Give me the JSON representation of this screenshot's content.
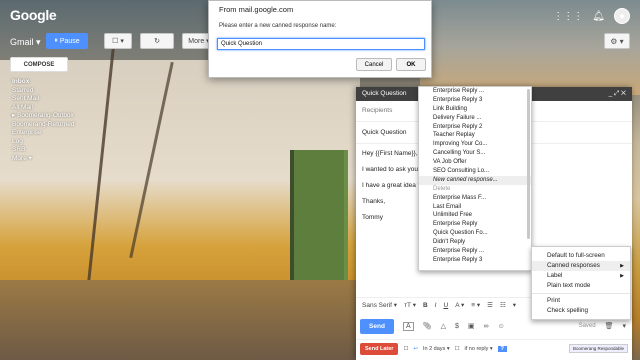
{
  "topbar": {
    "logo": "Google",
    "icons": [
      "grid-icon",
      "bell-icon",
      "avatar"
    ]
  },
  "toolbar": {
    "gmail_label": "Gmail ▾",
    "pause_label": "Pause",
    "more_label": "More ▾",
    "gear_label": "⚙ ▾"
  },
  "sidebar": {
    "compose_label": "COMPOSE",
    "items": [
      {
        "label": "Inbox",
        "bold": true
      },
      {
        "label": "Starred"
      },
      {
        "label": "Sent Mail"
      },
      {
        "label": "All Mail"
      },
      {
        "label": "▸ Boomerang-Outbox"
      },
      {
        "label": "Boomerang-Returned"
      },
      {
        "label": "Enterprise"
      },
      {
        "label": "Log"
      },
      {
        "label": "SRB"
      },
      {
        "label": "More ▾"
      }
    ]
  },
  "dialog": {
    "title": "From mail.google.com",
    "prompt": "Please enter a new canned response name:",
    "value": "Quick Question",
    "cancel_label": "Cancel",
    "ok_label": "OK"
  },
  "compose": {
    "header_title": "Quick Question",
    "header_controls": "_  ⤢  ✕",
    "recipients_placeholder": "Recipients",
    "subject": "Quick Question",
    "body": [
      "Hey {{First Name}},",
      "I wanted to ask you about                                                      mpany}} about widgets?",
      "I have a great idea f                                                          ad you {{Another Piece of Data}}.",
      "Thanks,",
      "Tommy"
    ],
    "format": {
      "font": "Sans Serif ▾",
      "size": "ᴛT ▾",
      "bold": "B",
      "italic": "I",
      "underline": "U",
      "color": "A ▾",
      "align": "≡ ▾",
      "list1": "☰",
      "list2": "☷",
      "more": "▾"
    },
    "send_label": "Send",
    "saved_label": "Saved",
    "send_later_label": "Send Later",
    "in_days": "In 2 days ▾",
    "if_no_reply": "if no reply ▾",
    "help": "?",
    "bm_respondable": "Boomerang Respondable"
  },
  "canned_list": {
    "items": [
      {
        "label": "Enterprise Reply ..."
      },
      {
        "label": "Enterprise Reply 3"
      },
      {
        "label": "Link Building"
      },
      {
        "label": "Delivery Failure ..."
      },
      {
        "label": "Enterprise Reply 2"
      },
      {
        "label": "Teacher Replay"
      },
      {
        "label": "Improving Your Co..."
      },
      {
        "label": "Cancelling Your S..."
      },
      {
        "label": "VA Job Offer"
      },
      {
        "label": "SEO Consulting Lo..."
      },
      {
        "label": "New canned response...",
        "highlight": true
      },
      {
        "label": "Delete",
        "header": true
      },
      {
        "label": "Enterprise Mass F..."
      },
      {
        "label": "Last Email"
      },
      {
        "label": "Unlimited Free"
      },
      {
        "label": "Enterprise Reply"
      },
      {
        "label": "Quick Question Fo..."
      },
      {
        "label": "Didn't Reply"
      },
      {
        "label": "Enterprise Reply ..."
      },
      {
        "label": "Enterprise Reply 3"
      }
    ]
  },
  "more_menu": {
    "items": [
      {
        "label": "Default to full-screen"
      },
      {
        "label": "Canned responses",
        "submenu": true,
        "highlight": true
      },
      {
        "label": "Label",
        "submenu": true
      },
      {
        "label": "Plain text mode"
      },
      {
        "label": "Print",
        "divider_before": true
      },
      {
        "label": "Check spelling"
      }
    ]
  }
}
